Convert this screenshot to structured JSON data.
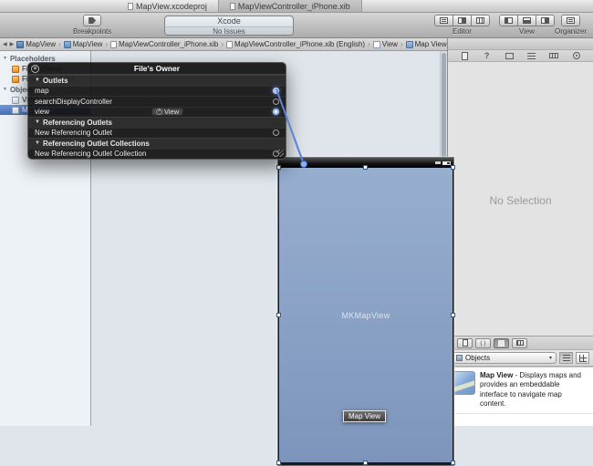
{
  "glyphs": {
    "disclosure": "▼",
    "chevron": "›",
    "back": "◀",
    "forward": "▶",
    "close": "×",
    "popup_arrow": "▾",
    "question": "?"
  },
  "colors": {
    "connection_line": "#5b82d8",
    "connection_dot_fill": "#8fb0ee",
    "connection_dot_stroke": "#3c63b8",
    "selection_handle": "#3c5a8c"
  },
  "titlebar": {
    "tabs": [
      {
        "label": "MapView.xcodeproj"
      },
      {
        "label": "MapViewController_iPhone.xib"
      }
    ]
  },
  "toolbar": {
    "breakpoints_label": "Breakpoints",
    "activity": {
      "app": "Xcode",
      "status": "No Issues"
    },
    "editor_label": "Editor",
    "view_label": "View",
    "organizer_label": "Organizer"
  },
  "jumpbar": {
    "crumbs": [
      {
        "label": "MapView"
      },
      {
        "label": "MapView"
      },
      {
        "label": "MapViewController_iPhone.xib"
      },
      {
        "label": "MapViewController_iPhone.xib (English)"
      },
      {
        "label": "View"
      },
      {
        "label": "Map View"
      }
    ]
  },
  "dock": {
    "sections": [
      {
        "title": "Placeholders"
      },
      {
        "title": "Objects"
      }
    ],
    "placeholders": [
      {
        "label": "File's Owner"
      },
      {
        "label": "First Responder"
      }
    ],
    "objects": [
      {
        "label": "View"
      },
      {
        "label": "Map View"
      }
    ]
  },
  "hud": {
    "title": "File's Owner",
    "outlets_header": "Outlets",
    "rows": [
      {
        "label": "map"
      },
      {
        "label": "searchDisplayController"
      },
      {
        "label": "view",
        "value": "View"
      }
    ],
    "referencing_header": "Referencing Outlets",
    "referencing_row": "New Referencing Outlet",
    "collections_header": "Referencing Outlet Collections",
    "collections_row": "New Referencing Outlet Collection"
  },
  "canvas": {
    "map_view_label": "MKMapView",
    "tooltip": "Map View"
  },
  "inspector": {
    "empty_message": "No Selection"
  },
  "library": {
    "filter_label": "Objects",
    "item": {
      "title": "Map View",
      "separator": " - ",
      "description": "Displays maps and provides an embeddable interface to navigate map content."
    }
  }
}
